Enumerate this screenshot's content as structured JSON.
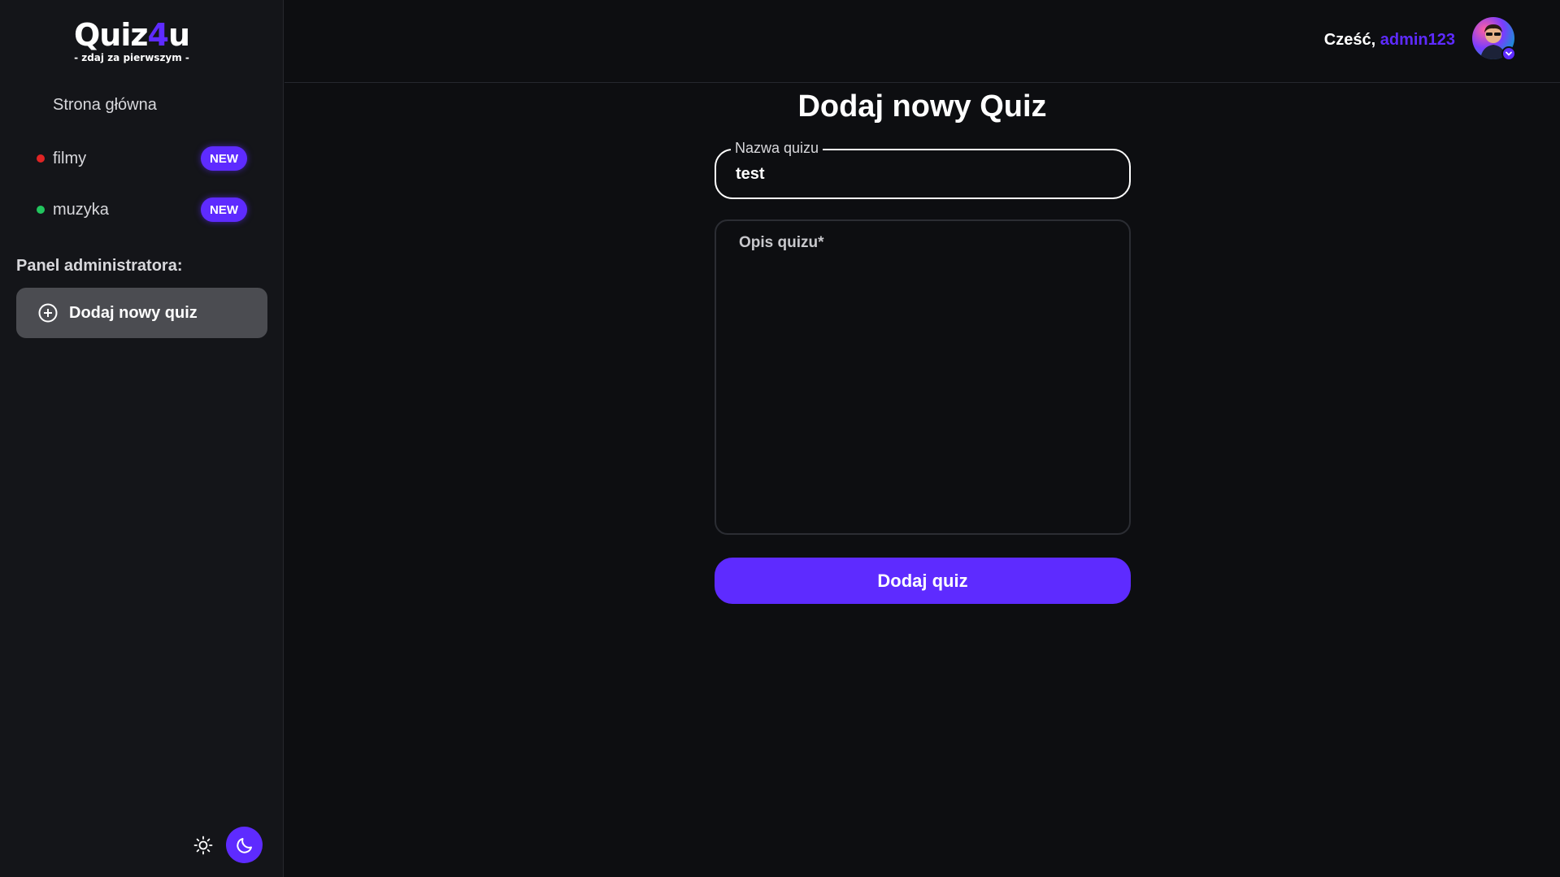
{
  "brand": {
    "name_prefix": "Quiz",
    "name_accent": "4",
    "name_suffix": "u",
    "tagline": "- zdaj za pierwszym -"
  },
  "sidebar": {
    "home_label": "Strona główna",
    "categories": [
      {
        "label": "filmy",
        "dot_color": "#e02424",
        "badge": "NEW"
      },
      {
        "label": "muzyka",
        "dot_color": "#22c55e",
        "badge": "NEW"
      }
    ],
    "admin_section_title": "Panel administratora:",
    "admin_add_quiz_label": "Dodaj nowy quiz",
    "admin_add_quiz_icon": "plus-circle-icon",
    "theme_light_icon": "sun-icon",
    "theme_dark_icon": "moon-icon"
  },
  "header": {
    "greeting": "Cześć,",
    "username": "admin123",
    "avatar_icon": "user-avatar",
    "avatar_badge_icon": "chevron-down-icon"
  },
  "form": {
    "title": "Dodaj nowy Quiz",
    "name_label": "Nazwa quizu",
    "name_value": "test",
    "description_placeholder": "Opis quizu*",
    "description_value": "",
    "submit_label": "Dodaj quiz"
  },
  "colors": {
    "accent": "#5e2bff",
    "background": "#0d0e11",
    "sidebar_bg": "#141519",
    "active_item_bg": "#4b4c51"
  }
}
